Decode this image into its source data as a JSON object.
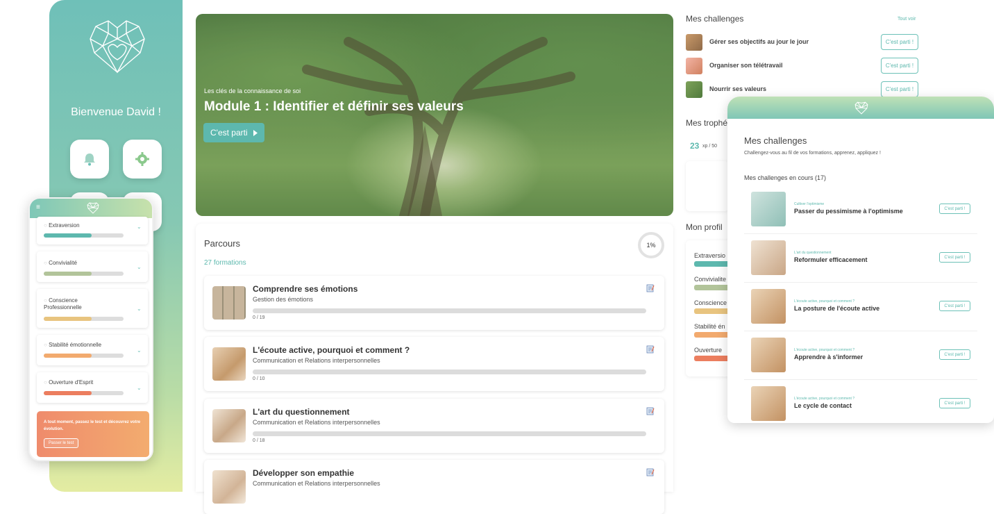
{
  "colors": {
    "teal": "#5db8ae",
    "orange": "#ef8b6c"
  },
  "sidebar": {
    "welcome": "Bienvenue David !",
    "icons": [
      "bell-icon",
      "gear-icon"
    ]
  },
  "hero": {
    "subtitle": "Les clés de la connaissance de soi",
    "title": "Module 1 : Identifier et définir ses valeurs",
    "cta": "C'est parti"
  },
  "parcours": {
    "title": "Parcours",
    "count": "27 formations",
    "progress": "1%",
    "courses": [
      {
        "title": "Comprendre ses émotions",
        "category": "Gestion des émotions",
        "progress": "0 / 19"
      },
      {
        "title": "L'écoute active, pourquoi et comment ?",
        "category": "Communication et Relations interpersonnelles",
        "progress": "0 / 10"
      },
      {
        "title": "L'art du questionnement",
        "category": "Communication et Relations interpersonnelles",
        "progress": "0 / 18"
      },
      {
        "title": "Développer son empathie",
        "category": "Communication et Relations interpersonnelles",
        "progress": ""
      }
    ]
  },
  "right": {
    "challenges_title": "Mes challenges",
    "see_all": "Tout voir",
    "challenges": [
      {
        "label": "Gérer ses objectifs au jour le jour",
        "btn": "C'est parti !"
      },
      {
        "label": "Organiser son télétravail",
        "btn": "C'est parti !"
      },
      {
        "label": "Nourrir ses valeurs",
        "btn": "C'est parti !"
      }
    ],
    "trophies_title": "Mes trophé",
    "xp_value": "23",
    "xp_total": "xp / 50",
    "profile_title": "Mon profil",
    "profile_items": [
      "Extraversio",
      "Convivialite",
      "Conscience",
      "Stabilité én",
      "Ouverture"
    ]
  },
  "phone": {
    "menu_icon": "≡",
    "traits": [
      {
        "label": "Extraversion",
        "color": "#5db8ae"
      },
      {
        "label": "Convivialité",
        "color": "#b2c49a"
      },
      {
        "label": "Conscience Professionnelle",
        "color": "#e8c47f"
      },
      {
        "label": "Stabilité émotionnelle",
        "color": "#f2aa6e"
      },
      {
        "label": "Ouverture d'Esprit",
        "color": "#ec7e5f"
      }
    ],
    "promo_text": "A tout moment, passez le test et découvrez votre évolution.",
    "promo_btn": "Passer le test"
  },
  "panel": {
    "title": "Mes challenges",
    "subtitle": "Challengez-vous au fil de vos formations, apprenez, appliquez !",
    "section": "Mes challenges en cours (17)",
    "items": [
      {
        "category": "Cultiver l'optimisme",
        "title": "Passer du pessimisme à l'optimisme",
        "btn": "C'est parti !"
      },
      {
        "category": "L'art du questionnement",
        "title": "Reformuler efficacement",
        "btn": "C'est parti !"
      },
      {
        "category": "L'écoute active, pourquoi et comment ?",
        "title": "La posture de l'écoute active",
        "btn": "C'est parti !"
      },
      {
        "category": "L'écoute active, pourquoi et comment ?",
        "title": "Apprendre à s'informer",
        "btn": "C'est parti !"
      },
      {
        "category": "L'écoute active, pourquoi et comment ?",
        "title": "Le cycle de contact",
        "btn": "C'est parti !"
      }
    ]
  }
}
